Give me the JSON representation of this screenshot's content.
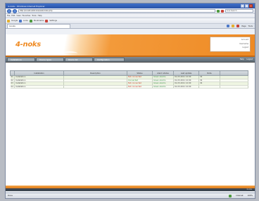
{
  "window": {
    "title": "4-noks - Windows Internet Explorer"
  },
  "browser": {
    "address": "http://localhost/4noks/web/index.php",
    "search_placeholder": "Live Search",
    "menu": [
      "File",
      "Edit",
      "View",
      "Favorites",
      "Tools",
      "Help"
    ],
    "bookmarks": [
      "Google",
      "Links",
      "Bookmarks",
      "Settings"
    ],
    "tab_title": "4-noks",
    "tab_tools": [
      "Page",
      "Tools"
    ]
  },
  "app": {
    "logo": "4-noks",
    "info": [
      "Account",
      "Username",
      "Logout"
    ],
    "nav": [
      {
        "label": "Installations"
      },
      {
        "label": "Device types"
      },
      {
        "label": "Device list"
      },
      {
        "label": "Configuration"
      }
    ],
    "nav_right": [
      "Help",
      "Logout"
    ]
  },
  "table": {
    "headers": [
      "",
      "Installation",
      "Description",
      "Status",
      "Alarm status",
      "Last update",
      "Note",
      ""
    ],
    "rows": [
      {
        "cells": [
          "01",
          "Installation",
          "",
          "Not connected",
          "Green alarms",
          "01-03-2011 12:00",
          "34",
          ""
        ],
        "status": "bad"
      },
      {
        "cells": [
          "02",
          "Installation",
          "",
          "Connected",
          "Green alarms",
          "01-03-2011 12:00",
          "34",
          ""
        ],
        "status": "ok"
      },
      {
        "cells": [
          "03",
          "Installation",
          "",
          "Not connected",
          "Green alarms",
          "01-03-2011 12:00",
          "34",
          ""
        ],
        "status": "bad"
      },
      {
        "cells": [
          "04",
          "Installation",
          "",
          "Not connected",
          "Green alarms",
          "01-03-2011 12:00",
          "",
          ""
        ],
        "status": "bad"
      }
    ]
  },
  "footer": {
    "text": "4-noks"
  },
  "status": {
    "left": "Done",
    "zone": "Internet",
    "zoom": "100%"
  }
}
